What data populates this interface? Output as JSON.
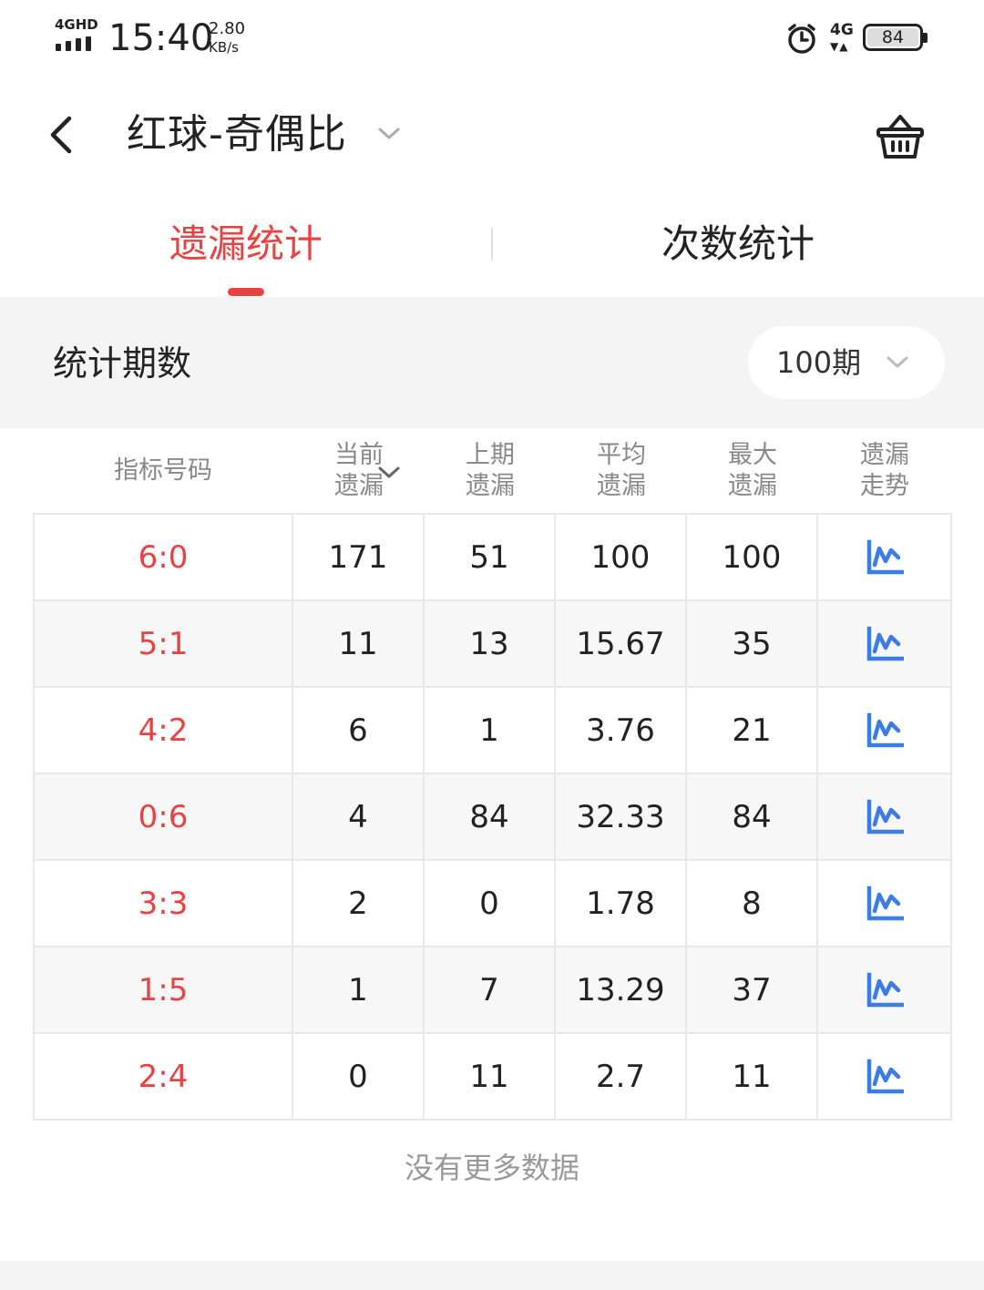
{
  "status_bar": {
    "network": "4GHD",
    "time": "15:40",
    "speed": "2.80",
    "speed_unit": "KB/s",
    "data_type": "4G",
    "battery": "84"
  },
  "header": {
    "title": "红球-奇偶比"
  },
  "tabs": [
    {
      "label": "遗漏统计",
      "active": true
    },
    {
      "label": "次数统计",
      "active": false
    }
  ],
  "period": {
    "label": "统计期数",
    "value": "100期"
  },
  "table": {
    "headers": [
      "指标号码",
      "当前遗漏",
      "上期遗漏",
      "平均遗漏",
      "最大遗漏",
      "遗漏走势"
    ],
    "rows": [
      {
        "code": "6:0",
        "current": "171",
        "last": "51",
        "avg": "100",
        "max": "100"
      },
      {
        "code": "5:1",
        "current": "11",
        "last": "13",
        "avg": "15.67",
        "max": "35"
      },
      {
        "code": "4:2",
        "current": "6",
        "last": "1",
        "avg": "3.76",
        "max": "21"
      },
      {
        "code": "0:6",
        "current": "4",
        "last": "84",
        "avg": "32.33",
        "max": "84"
      },
      {
        "code": "3:3",
        "current": "2",
        "last": "0",
        "avg": "1.78",
        "max": "8"
      },
      {
        "code": "1:5",
        "current": "1",
        "last": "7",
        "avg": "13.29",
        "max": "37"
      },
      {
        "code": "2:4",
        "current": "0",
        "last": "11",
        "avg": "2.7",
        "max": "11"
      }
    ]
  },
  "footer": {
    "no_more": "没有更多数据"
  },
  "colors": {
    "accent": "#e84343",
    "trend_icon": "#3d7be6",
    "muted": "#888888"
  }
}
